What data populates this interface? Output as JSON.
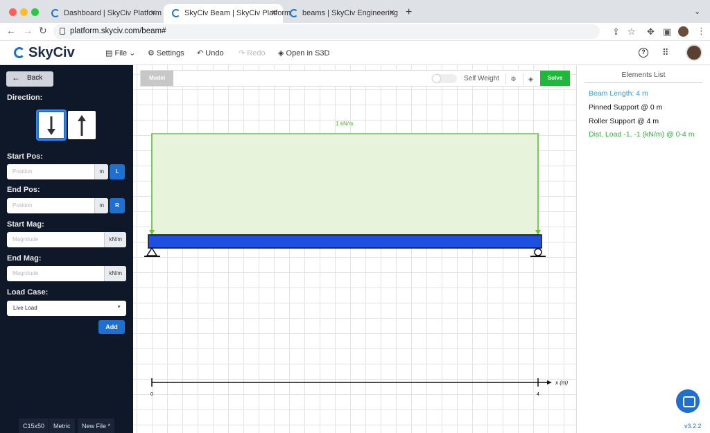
{
  "browser": {
    "tabs": [
      {
        "title": "Dashboard | SkyCiv Platform",
        "active": false
      },
      {
        "title": "SkyCiv Beam | SkyCiv Platform",
        "active": true
      },
      {
        "title": "beams | SkyCiv Engineering",
        "active": false
      }
    ],
    "url": "platform.skyciv.com/beam#"
  },
  "app": {
    "logo": "SkyCiv",
    "menu": {
      "file": "File",
      "settings": "Settings",
      "undo": "Undo",
      "redo": "Redo",
      "open_s3d": "Open in S3D"
    }
  },
  "left_panel": {
    "back_label": "Back",
    "direction_label": "Direction:",
    "direction_selected": "down",
    "start_pos_label": "Start Pos:",
    "start_pos_placeholder": "Position",
    "start_pos_unit": "m",
    "start_pos_button": "L",
    "end_pos_label": "End Pos:",
    "end_pos_placeholder": "Position",
    "end_pos_unit": "m",
    "end_pos_button": "R",
    "start_mag_label": "Start Mag:",
    "start_mag_placeholder": "Magnitude",
    "start_mag_unit": "kN/m",
    "end_mag_label": "End Mag:",
    "end_mag_placeholder": "Magnitude",
    "end_mag_unit": "kN/m",
    "load_case_label": "Load Case:",
    "load_case_value": "Live Load",
    "add_label": "Add",
    "footer": {
      "section": "C15x50",
      "units": "Metric",
      "new_file": "New File *"
    }
  },
  "canvas": {
    "model_label": "Model",
    "self_weight_label": "Self Weight",
    "solve_label": "Solve",
    "load_label": "1 kN/m",
    "axis_label": "x (m)",
    "axis_start": "0",
    "axis_end": "4",
    "colors": {
      "beam": "#1f4fe0",
      "load_fill": "#e8f3dc",
      "load_stroke": "#6cc04a"
    }
  },
  "elements_list": {
    "title": "Elements List",
    "items": [
      {
        "text": "Beam Length: 4 m",
        "color": "#2f9fe0"
      },
      {
        "text": "Pinned Support @ 0 m",
        "color": "#111111"
      },
      {
        "text": "Roller Support @ 4 m",
        "color": "#111111"
      },
      {
        "text": "Dist. Load -1, -1 (kN/m) @ 0-4 m",
        "color": "#2fae3a"
      }
    ]
  },
  "version": "v3.2.2"
}
